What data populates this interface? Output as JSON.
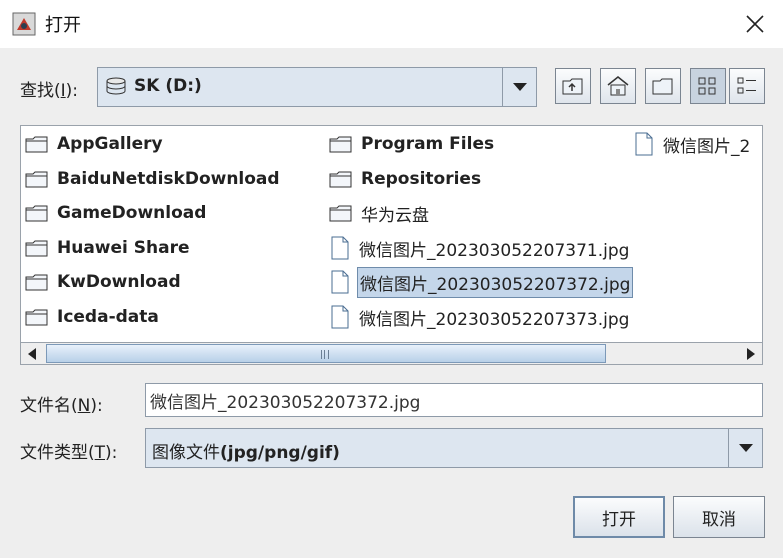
{
  "window": {
    "title": "打开"
  },
  "lookin": {
    "label": "查找(",
    "mnemonic": "I",
    "label_tail": "):",
    "value": "SK (D:)"
  },
  "toolbar": {
    "icons": [
      "up-folder-icon",
      "home-icon",
      "new-folder-icon",
      "list-view-icon",
      "details-view-icon"
    ],
    "active_view": "list"
  },
  "files": {
    "col1": [
      {
        "name": "AppGallery",
        "type": "folder"
      },
      {
        "name": "BaiduNetdiskDownload",
        "type": "folder"
      },
      {
        "name": "GameDownload",
        "type": "folder"
      },
      {
        "name": "Huawei Share",
        "type": "folder"
      },
      {
        "name": "KwDownload",
        "type": "folder"
      },
      {
        "name": "Iceda-data",
        "type": "folder"
      }
    ],
    "col2": [
      {
        "name": "Program Files",
        "type": "folder"
      },
      {
        "name": "Repositories",
        "type": "folder"
      },
      {
        "name": "华为云盘",
        "type": "folder"
      },
      {
        "name": "微信图片_202303052207371.jpg",
        "type": "file"
      },
      {
        "name": "微信图片_202303052207372.jpg",
        "type": "file",
        "selected": true
      },
      {
        "name": "微信图片_202303052207373.jpg",
        "type": "file"
      }
    ],
    "col3": [
      {
        "name": "微信图片_2",
        "type": "file"
      }
    ]
  },
  "filename": {
    "label": "文件名(",
    "mnemonic": "N",
    "label_tail": "):",
    "value": "微信图片_202303052207372.jpg"
  },
  "filetype": {
    "label": "文件类型(",
    "mnemonic": "T",
    "label_tail": "):",
    "value_cjk": "图像文件",
    "value_latin": "(jpg/png/gif)"
  },
  "buttons": {
    "open": "打开",
    "cancel": "取消"
  },
  "colors": {
    "selection": "#c4d6ea",
    "combo_bg": "#dde6f0",
    "dialog_bg": "#eeeeee"
  }
}
